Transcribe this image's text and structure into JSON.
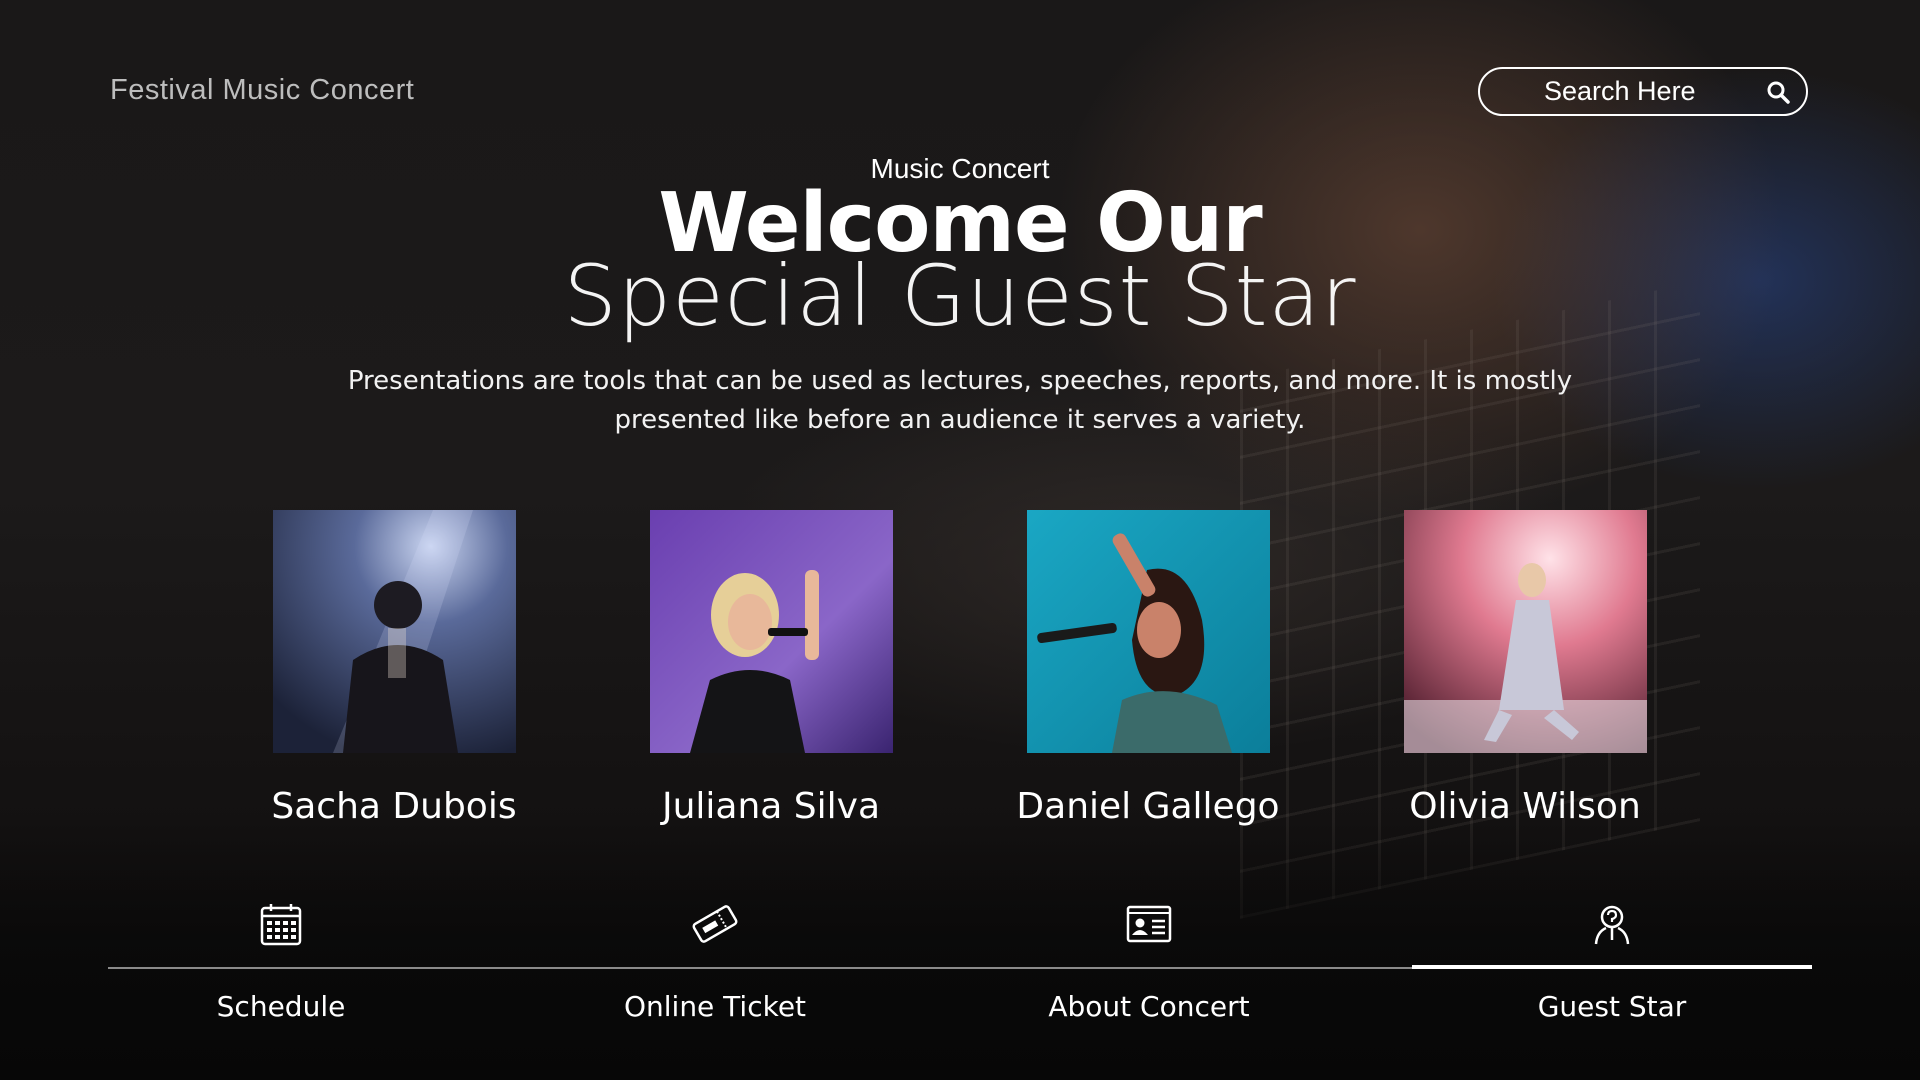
{
  "header": {
    "brand": "Festival Music Concert",
    "search_placeholder": "Search Here"
  },
  "hero": {
    "eyebrow": "Music Concert",
    "title_line1": "Welcome Our",
    "title_line2": "Special Guest Star",
    "description": "Presentations are tools that can be used as lectures, speeches, reports, and more. It is mostly presented like before an audience it serves a variety."
  },
  "guest_stars": [
    {
      "name": "Sacha Dubois"
    },
    {
      "name": "Juliana Silva"
    },
    {
      "name": "Daniel Gallego"
    },
    {
      "name": "Olivia Wilson"
    }
  ],
  "nav": {
    "items": [
      {
        "label": "Schedule",
        "icon": "calendar-icon"
      },
      {
        "label": "Online Ticket",
        "icon": "ticket-icon"
      },
      {
        "label": "About Concert",
        "icon": "id-card-icon"
      },
      {
        "label": "Guest Star",
        "icon": "guest-star-icon"
      }
    ],
    "active": "Guest Star"
  },
  "colors": {
    "text": "#ffffff",
    "brand_text": "#bdbdbd",
    "background": "#141212",
    "rule": "#8a8a8a"
  }
}
